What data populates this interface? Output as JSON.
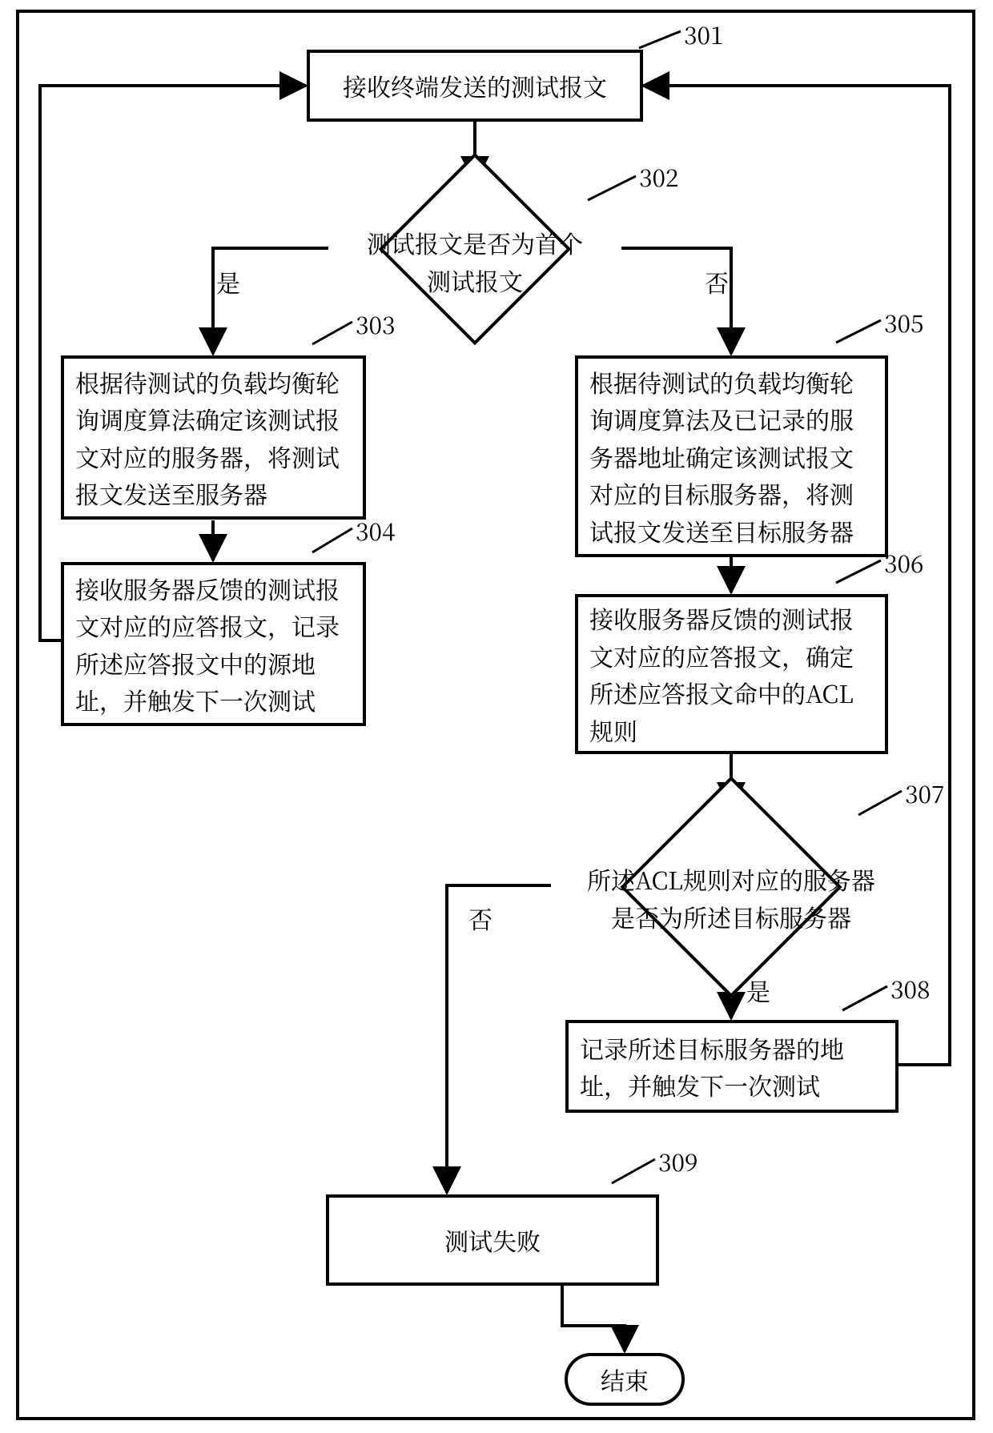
{
  "nodes": {
    "n301": {
      "text": "接收终端发送的测试报文",
      "ref": "301"
    },
    "n302": {
      "text": "测试报文是否为首个\n测试报文",
      "ref": "302"
    },
    "n303": {
      "text": "根据待测试的负载均衡轮询调度算法确定该测试报文对应的服务器，将测试报文发送至服务器",
      "ref": "303"
    },
    "n304": {
      "text": "接收服务器反馈的测试报文对应的应答报文，记录所述应答报文中的源地址，并触发下一次测试",
      "ref": "304"
    },
    "n305": {
      "text": "根据待测试的负载均衡轮询调度算法及已记录的服务器地址确定该测试报文对应的目标服务器，将测试报文发送至目标服务器",
      "ref": "305"
    },
    "n306": {
      "text": "接收服务器反馈的测试报文对应的应答报文，确定所述应答报文命中的ACL规则",
      "ref": "306"
    },
    "n307": {
      "text": "所述ACL规则对应的服务器\n是否为所述目标服务器",
      "ref": "307"
    },
    "n308": {
      "text": "记录所述目标服务器的地址，并触发下一次测试",
      "ref": "308"
    },
    "n309": {
      "text": "测试失败",
      "ref": "309"
    },
    "end": {
      "text": "结束"
    }
  },
  "labels": {
    "yes": "是",
    "no": "否"
  }
}
